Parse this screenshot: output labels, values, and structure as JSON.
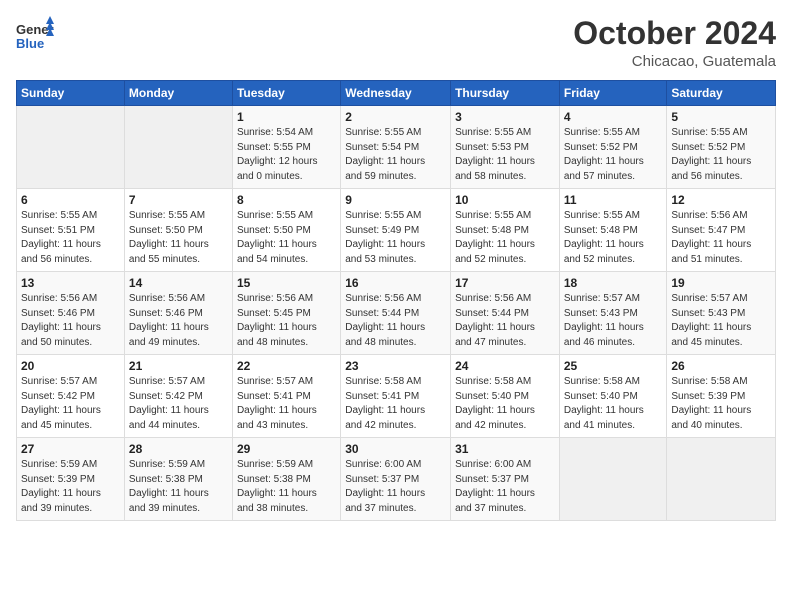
{
  "header": {
    "logo_general": "General",
    "logo_blue": "Blue",
    "month": "October 2024",
    "location": "Chicacao, Guatemala"
  },
  "weekdays": [
    "Sunday",
    "Monday",
    "Tuesday",
    "Wednesday",
    "Thursday",
    "Friday",
    "Saturday"
  ],
  "weeks": [
    [
      {
        "day": "",
        "detail": ""
      },
      {
        "day": "",
        "detail": ""
      },
      {
        "day": "1",
        "detail": "Sunrise: 5:54 AM\nSunset: 5:55 PM\nDaylight: 12 hours\nand 0 minutes."
      },
      {
        "day": "2",
        "detail": "Sunrise: 5:55 AM\nSunset: 5:54 PM\nDaylight: 11 hours\nand 59 minutes."
      },
      {
        "day": "3",
        "detail": "Sunrise: 5:55 AM\nSunset: 5:53 PM\nDaylight: 11 hours\nand 58 minutes."
      },
      {
        "day": "4",
        "detail": "Sunrise: 5:55 AM\nSunset: 5:52 PM\nDaylight: 11 hours\nand 57 minutes."
      },
      {
        "day": "5",
        "detail": "Sunrise: 5:55 AM\nSunset: 5:52 PM\nDaylight: 11 hours\nand 56 minutes."
      }
    ],
    [
      {
        "day": "6",
        "detail": "Sunrise: 5:55 AM\nSunset: 5:51 PM\nDaylight: 11 hours\nand 56 minutes."
      },
      {
        "day": "7",
        "detail": "Sunrise: 5:55 AM\nSunset: 5:50 PM\nDaylight: 11 hours\nand 55 minutes."
      },
      {
        "day": "8",
        "detail": "Sunrise: 5:55 AM\nSunset: 5:50 PM\nDaylight: 11 hours\nand 54 minutes."
      },
      {
        "day": "9",
        "detail": "Sunrise: 5:55 AM\nSunset: 5:49 PM\nDaylight: 11 hours\nand 53 minutes."
      },
      {
        "day": "10",
        "detail": "Sunrise: 5:55 AM\nSunset: 5:48 PM\nDaylight: 11 hours\nand 52 minutes."
      },
      {
        "day": "11",
        "detail": "Sunrise: 5:55 AM\nSunset: 5:48 PM\nDaylight: 11 hours\nand 52 minutes."
      },
      {
        "day": "12",
        "detail": "Sunrise: 5:56 AM\nSunset: 5:47 PM\nDaylight: 11 hours\nand 51 minutes."
      }
    ],
    [
      {
        "day": "13",
        "detail": "Sunrise: 5:56 AM\nSunset: 5:46 PM\nDaylight: 11 hours\nand 50 minutes."
      },
      {
        "day": "14",
        "detail": "Sunrise: 5:56 AM\nSunset: 5:46 PM\nDaylight: 11 hours\nand 49 minutes."
      },
      {
        "day": "15",
        "detail": "Sunrise: 5:56 AM\nSunset: 5:45 PM\nDaylight: 11 hours\nand 48 minutes."
      },
      {
        "day": "16",
        "detail": "Sunrise: 5:56 AM\nSunset: 5:44 PM\nDaylight: 11 hours\nand 48 minutes."
      },
      {
        "day": "17",
        "detail": "Sunrise: 5:56 AM\nSunset: 5:44 PM\nDaylight: 11 hours\nand 47 minutes."
      },
      {
        "day": "18",
        "detail": "Sunrise: 5:57 AM\nSunset: 5:43 PM\nDaylight: 11 hours\nand 46 minutes."
      },
      {
        "day": "19",
        "detail": "Sunrise: 5:57 AM\nSunset: 5:43 PM\nDaylight: 11 hours\nand 45 minutes."
      }
    ],
    [
      {
        "day": "20",
        "detail": "Sunrise: 5:57 AM\nSunset: 5:42 PM\nDaylight: 11 hours\nand 45 minutes."
      },
      {
        "day": "21",
        "detail": "Sunrise: 5:57 AM\nSunset: 5:42 PM\nDaylight: 11 hours\nand 44 minutes."
      },
      {
        "day": "22",
        "detail": "Sunrise: 5:57 AM\nSunset: 5:41 PM\nDaylight: 11 hours\nand 43 minutes."
      },
      {
        "day": "23",
        "detail": "Sunrise: 5:58 AM\nSunset: 5:41 PM\nDaylight: 11 hours\nand 42 minutes."
      },
      {
        "day": "24",
        "detail": "Sunrise: 5:58 AM\nSunset: 5:40 PM\nDaylight: 11 hours\nand 42 minutes."
      },
      {
        "day": "25",
        "detail": "Sunrise: 5:58 AM\nSunset: 5:40 PM\nDaylight: 11 hours\nand 41 minutes."
      },
      {
        "day": "26",
        "detail": "Sunrise: 5:58 AM\nSunset: 5:39 PM\nDaylight: 11 hours\nand 40 minutes."
      }
    ],
    [
      {
        "day": "27",
        "detail": "Sunrise: 5:59 AM\nSunset: 5:39 PM\nDaylight: 11 hours\nand 39 minutes."
      },
      {
        "day": "28",
        "detail": "Sunrise: 5:59 AM\nSunset: 5:38 PM\nDaylight: 11 hours\nand 39 minutes."
      },
      {
        "day": "29",
        "detail": "Sunrise: 5:59 AM\nSunset: 5:38 PM\nDaylight: 11 hours\nand 38 minutes."
      },
      {
        "day": "30",
        "detail": "Sunrise: 6:00 AM\nSunset: 5:37 PM\nDaylight: 11 hours\nand 37 minutes."
      },
      {
        "day": "31",
        "detail": "Sunrise: 6:00 AM\nSunset: 5:37 PM\nDaylight: 11 hours\nand 37 minutes."
      },
      {
        "day": "",
        "detail": ""
      },
      {
        "day": "",
        "detail": ""
      }
    ]
  ]
}
